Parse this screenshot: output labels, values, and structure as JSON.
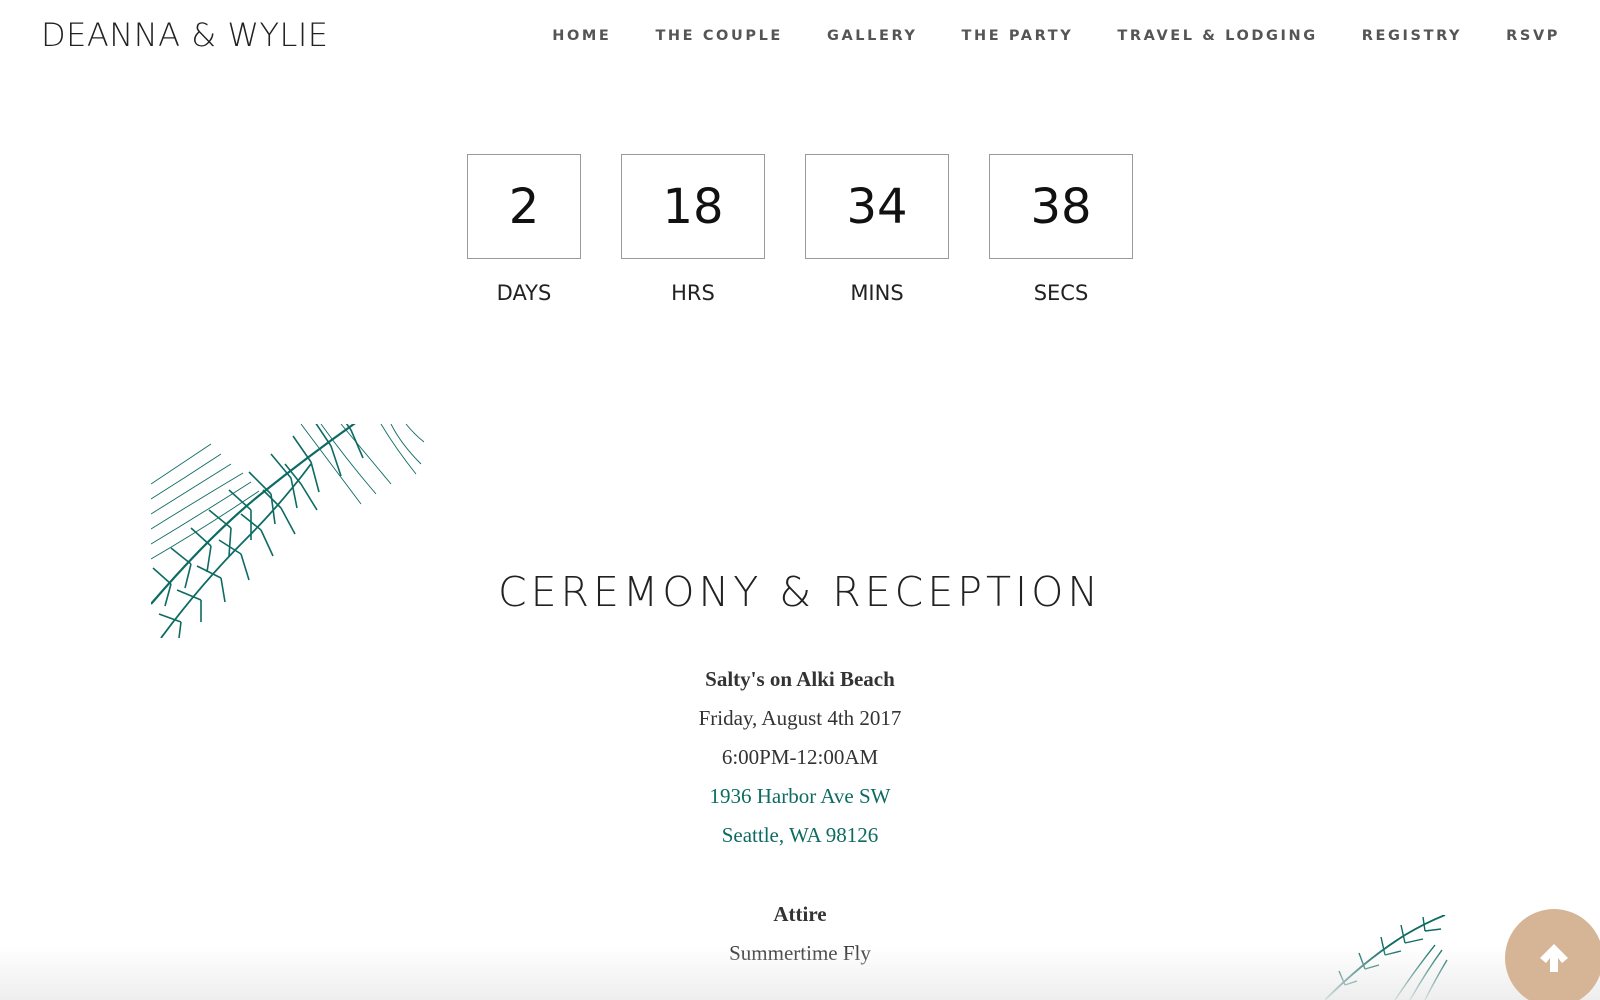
{
  "header": {
    "site_title": "DEANNA & WYLIE",
    "nav": [
      {
        "label": "HOME"
      },
      {
        "label": "THE COUPLE"
      },
      {
        "label": "GALLERY"
      },
      {
        "label": "THE PARTY"
      },
      {
        "label": "TRAVEL & LODGING"
      },
      {
        "label": "REGISTRY"
      },
      {
        "label": "RSVP"
      }
    ]
  },
  "countdown": [
    {
      "value": "2",
      "label": "DAYS"
    },
    {
      "value": "18",
      "label": "HRS"
    },
    {
      "value": "34",
      "label": "MINS"
    },
    {
      "value": "38",
      "label": "SECS"
    }
  ],
  "section": {
    "title": "CEREMONY & RECEPTION",
    "venue": "Salty's on Alki Beach",
    "date": "Friday, August 4th 2017",
    "time": "6:00PM-12:00AM",
    "address_line1": "1936 Harbor Ave SW",
    "address_line2": "Seattle, WA 98126",
    "attire_heading": "Attire",
    "attire_value": "Summertime Fly"
  },
  "decor": {
    "fern_color": "#0e6b63",
    "link_color": "#0e6b63",
    "to_top_color": "#d6b597",
    "fern_icon": "fern-illustration",
    "to_top_icon": "arrow-up-icon"
  }
}
